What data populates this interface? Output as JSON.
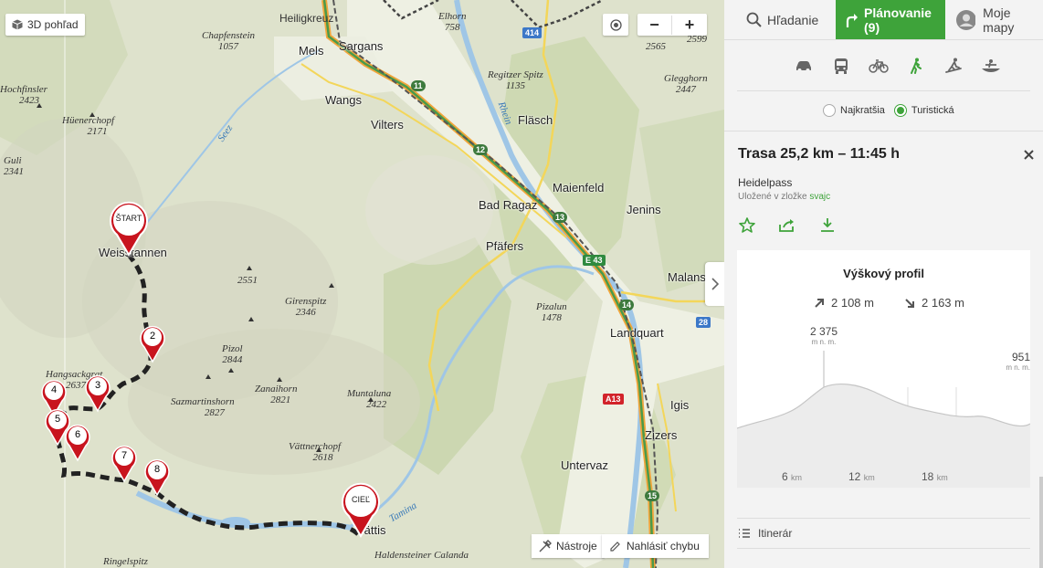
{
  "map": {
    "view_3d_label": "3D pohľad",
    "zoom_out": "−",
    "zoom_in": "+",
    "tools_label": "Nástroje",
    "report_label": "Nahlásiť chybu",
    "places": [
      {
        "name": "Heiligkreuz",
        "elev": ""
      },
      {
        "name": "Mels",
        "elev": ""
      },
      {
        "name": "Sargans",
        "elev": ""
      },
      {
        "name": "Wangs",
        "elev": ""
      },
      {
        "name": "Vilters",
        "elev": ""
      },
      {
        "name": "Fläsch",
        "elev": ""
      },
      {
        "name": "Maienfeld",
        "elev": ""
      },
      {
        "name": "Bad Ragaz",
        "elev": ""
      },
      {
        "name": "Jenins",
        "elev": ""
      },
      {
        "name": "Pfäfers",
        "elev": ""
      },
      {
        "name": "Malans",
        "elev": ""
      },
      {
        "name": "Landquart",
        "elev": ""
      },
      {
        "name": "Igis",
        "elev": ""
      },
      {
        "name": "Zizers",
        "elev": ""
      },
      {
        "name": "Untervaz",
        "elev": ""
      },
      {
        "name": "Weisstannen",
        "elev": ""
      },
      {
        "name": "Vättis",
        "elev": ""
      }
    ],
    "peaks": [
      {
        "name": "Chapfenstein",
        "elev": "1057"
      },
      {
        "name": "Elhorn",
        "elev": "758"
      },
      {
        "name": "",
        "elev": "2599"
      },
      {
        "name": "",
        "elev": "2565"
      },
      {
        "name": "Regitzer Spitz",
        "elev": "1135"
      },
      {
        "name": "Glegghorn",
        "elev": "2447"
      },
      {
        "name": "Hochfinsler",
        "elev": "2423"
      },
      {
        "name": "Hüenerchopf",
        "elev": "2171"
      },
      {
        "name": "Guli",
        "elev": "2341"
      },
      {
        "name": "",
        "elev": "2551"
      },
      {
        "name": "Girenspitz",
        "elev": "2346"
      },
      {
        "name": "Pizalun",
        "elev": "1478"
      },
      {
        "name": "Pizol",
        "elev": "2844"
      },
      {
        "name": "Sazmartinshorn",
        "elev": "2827"
      },
      {
        "name": "Zanaihorn",
        "elev": "2821"
      },
      {
        "name": "Muntaluna",
        "elev": "2422"
      },
      {
        "name": "Vättnerchopf",
        "elev": "2618"
      },
      {
        "name": "Hangsackgrat",
        "elev": "2637"
      }
    ],
    "water": [
      "Rhein",
      "Seez",
      "Tamina"
    ],
    "extra_labels": [
      "Haldensteiner Calanda",
      "Ringelspitz"
    ],
    "road_badges": [
      "414",
      "11",
      "12",
      "13",
      "E 43",
      "14",
      "28",
      "A13",
      "15"
    ],
    "start_label": "ŠTART",
    "end_label": "CIEĽ",
    "waypoints": [
      "2",
      "3",
      "4",
      "5",
      "6",
      "7",
      "8"
    ]
  },
  "panel": {
    "tabs": [
      {
        "label": "Hľadanie",
        "icon": "search-icon"
      },
      {
        "label": "Plánovanie (9)",
        "icon": "route-icon"
      },
      {
        "label": "Moje mapy",
        "icon": "user-icon"
      }
    ],
    "modes": [
      "car-icon",
      "bus-icon",
      "bicycle-icon",
      "hiking-icon",
      "ski-icon",
      "boat-icon"
    ],
    "route_options": [
      {
        "label": "Najkratšia",
        "selected": false
      },
      {
        "label": "Turistická",
        "selected": true
      }
    ],
    "route_title": "Trasa 25,2 km – 11:45 h",
    "route_name": "Heidelpass",
    "saved_prefix": "Uložené v zložke",
    "saved_folder": "svajc",
    "profile": {
      "title": "Výškový profil",
      "ascent": "2 108 m",
      "descent": "2 163 m",
      "max_value": "2 375",
      "max_unit": "m n. m.",
      "end_value": "951",
      "end_unit": "m n. m.",
      "km_ticks": [
        {
          "value": "6",
          "unit": "km"
        },
        {
          "value": "12",
          "unit": "km"
        },
        {
          "value": "18",
          "unit": "km"
        }
      ]
    },
    "itinerary_label": "Itinerár",
    "colors": {
      "accent": "#3ea33a",
      "pin": "#c8141e",
      "link": "#3ea33a"
    }
  }
}
